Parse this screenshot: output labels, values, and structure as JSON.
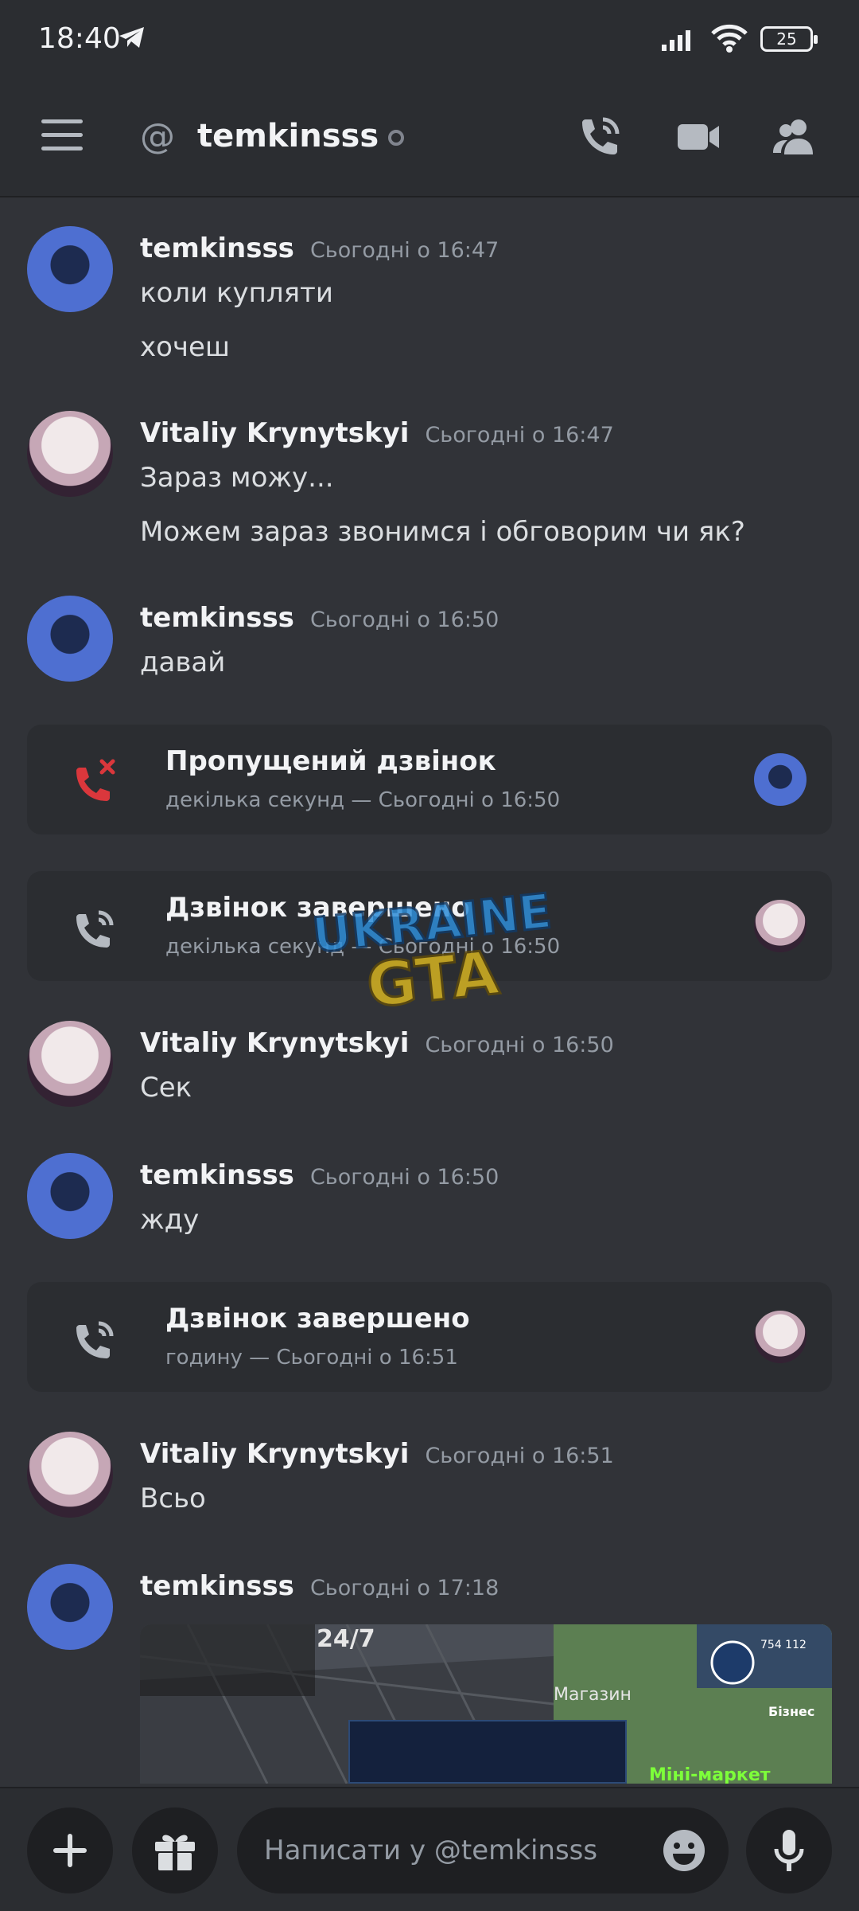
{
  "status_bar": {
    "time": "18:40",
    "battery": "25",
    "network": "6"
  },
  "header": {
    "channel": "temkinsss",
    "icons": [
      "menu-icon",
      "at-icon",
      "voice-call-icon",
      "video-call-icon",
      "members-icon"
    ]
  },
  "messages": [
    {
      "author": "temkinsss",
      "timestamp": "Сьогодні о 16:47",
      "lines": [
        "коли купляти",
        "хочеш"
      ]
    },
    {
      "author": "Vitaliy Krynytskyi",
      "timestamp": "Сьогодні о 16:47",
      "lines": [
        "Зараз можу...",
        "Можем зараз звонимся і обговорим чи як?"
      ]
    },
    {
      "author": "temkinsss",
      "timestamp": "Сьогодні о 16:50",
      "lines": [
        "давай"
      ]
    },
    {
      "author": "Vitaliy Krynytskyi",
      "timestamp": "Сьогодні о 16:50",
      "lines": [
        "Сек"
      ]
    },
    {
      "author": "temkinsss",
      "timestamp": "Сьогодні о 16:50",
      "lines": [
        "жду"
      ]
    },
    {
      "author": "Vitaliy Krynytskyi",
      "timestamp": "Сьогодні о 16:51",
      "lines": [
        "Всьо"
      ]
    },
    {
      "author": "temkinsss",
      "timestamp": "Сьогодні о 17:18",
      "lines": []
    }
  ],
  "calls": [
    {
      "title": "Пропущений дзвінок",
      "subtitle": "декілька секунд — Сьогодні о 16:50",
      "status": "missed",
      "color": "#da373c"
    },
    {
      "title": "Дзвінок завершено",
      "subtitle": "декілька секунд — Сьогодні о 16:50",
      "status": "ended",
      "color": "#b5bac1"
    },
    {
      "title": "Дзвінок завершено",
      "subtitle": "годину — Сьогодні о 16:51",
      "status": "ended",
      "color": "#b5bac1"
    }
  ],
  "attachment": {
    "kind": "game screenshot",
    "visible_text": [
      "Бізнес",
      "Міні-маркет",
      "Магазин",
      "754 112",
      "24/7"
    ]
  },
  "watermark": [
    "UKRAINE",
    "GTA"
  ],
  "composer": {
    "placeholder": "Написати у @temkinsss"
  },
  "colors": {
    "background": "#313338",
    "header": "#2b2d31",
    "missed": "#da373c",
    "muted": "#949ba4"
  }
}
